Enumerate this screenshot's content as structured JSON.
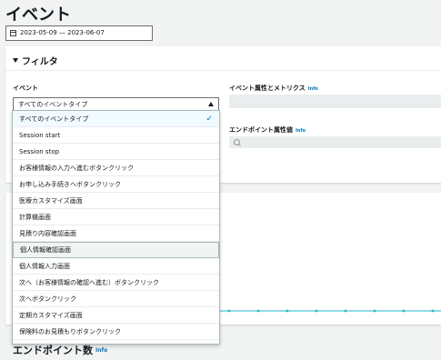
{
  "page": {
    "title": "イベント",
    "date_range": "2023-05-09 — 2023-06-07"
  },
  "filter": {
    "title": "フィルタ",
    "event_label": "イベント",
    "event_selected": "すべてのイベントタイプ",
    "metric_label": "イベント属性とメトリクス",
    "endpoint_attr_label": "エンドポイント属性値",
    "info_label": "Info"
  },
  "dropdown": {
    "options": [
      "すべてのイベントタイプ",
      "Session start",
      "Session stop",
      "お客様情報の入力へ進むボタンクリック",
      "お申し込み手続きへボタンクリック",
      "医療カスタマイズ画面",
      "計算機画面",
      "見積り内容確認画面",
      "個人情報確認画面",
      "個人情報入力画面",
      "次へ（お客様情報の確認へ進む）ボタンクリック",
      "次へボタンクリック",
      "定期カスタマイズ画面",
      "保険料のお見積もりボタンクリック"
    ],
    "selected_index": 0,
    "hover_index": 8
  },
  "endpoint": {
    "title": "エンドポイント数",
    "info_label": "Info"
  },
  "colors": {
    "accent": "#0073bb",
    "line": "#1fb6c9"
  }
}
